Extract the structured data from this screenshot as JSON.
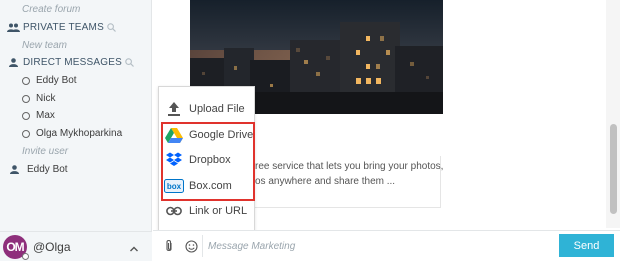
{
  "sidebar": {
    "create_forum": "Create forum",
    "private_teams": {
      "title": "PRIVATE TEAMS",
      "icon": "people-icon",
      "new_team": "New team"
    },
    "direct_messages": {
      "title": "DIRECT MESSAGES",
      "icon": "person-icon",
      "items": [
        {
          "label": "Eddy Bot",
          "status": "offline"
        },
        {
          "label": "Nick",
          "status": "offline"
        },
        {
          "label": "Max",
          "status": "offline"
        },
        {
          "label": "Olga Mykhoparkina",
          "status": "offline"
        }
      ],
      "invite_user": "Invite user"
    },
    "bot_user": "Eddy Bot",
    "footer": {
      "avatar_initials": "OM",
      "avatar_color": "#8e2f7b",
      "username": "@Olga"
    }
  },
  "main": {
    "link_preview_text_line1": "ree service that lets you bring your photos,",
    "link_preview_text_line2": "os anywhere and share them ..."
  },
  "attach_menu": {
    "items": [
      {
        "label": "Upload File",
        "icon": "upload-icon"
      },
      {
        "label": "Google Drive",
        "icon": "google-drive-icon"
      },
      {
        "label": "Dropbox",
        "icon": "dropbox-icon"
      },
      {
        "label": "Box.com",
        "icon": "box-icon"
      },
      {
        "label": "Link or URL",
        "icon": "link-icon"
      }
    ],
    "highlight_color": "#e0332d"
  },
  "composer": {
    "placeholder": "Message Marketing",
    "send_label": "Send",
    "send_color": "#2fb3d6"
  }
}
